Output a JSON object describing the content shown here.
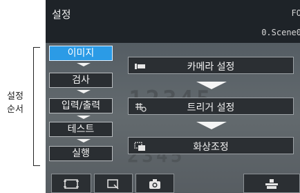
{
  "annotation": {
    "line1": "설정",
    "line2": "순서"
  },
  "titlebar": {
    "title": "설정",
    "right_label": "FO",
    "scene": "0.Scene0"
  },
  "background": {
    "text1": "12345",
    "text2": "2345"
  },
  "steps": [
    {
      "label": "이미지",
      "active": true
    },
    {
      "label": "검사",
      "active": false
    },
    {
      "label": "입력/출력",
      "active": false
    },
    {
      "label": "테스트",
      "active": false
    },
    {
      "label": "실행",
      "active": false
    }
  ],
  "panel": {
    "buttons": [
      {
        "label": "카메라 설정",
        "icon": "camera-settings-icon"
      },
      {
        "label": "트리거 설정",
        "icon": "trigger-settings-icon"
      },
      {
        "label": "화상조정",
        "icon": "image-adjust-icon"
      }
    ]
  },
  "toolbar": {
    "buttons": [
      {
        "icon": "frame-icon"
      },
      {
        "icon": "zoom-window-icon"
      },
      {
        "icon": "camera-icon"
      },
      {
        "icon": "save-icon"
      }
    ]
  },
  "colors": {
    "active": "#2b9be6",
    "titlebar": "#1e2328",
    "button": "#2b2f33"
  }
}
